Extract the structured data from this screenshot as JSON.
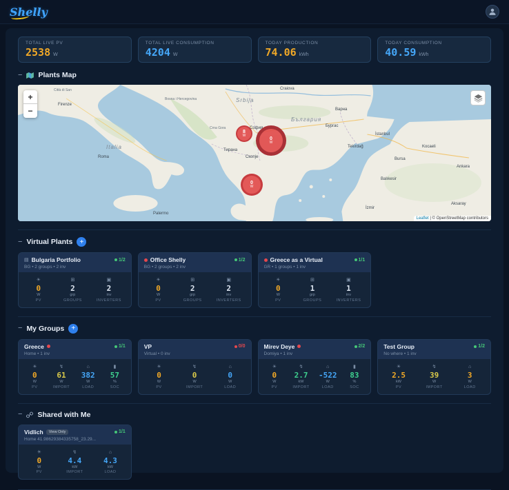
{
  "colors": {
    "accent_blue": "#2f80ed",
    "value_orange": "#f0a827",
    "value_blue": "#45a6f7",
    "value_yellow": "#d9c94a",
    "value_green": "#3ecf8e",
    "status_green": "#46c878",
    "status_red": "#e5484d",
    "marker_red": "#e24c4c"
  },
  "topbar": {
    "logo": "Shelly"
  },
  "stats": {
    "items": [
      {
        "label": "TOTAL LIVE PV",
        "value": "2538",
        "unit": "W"
      },
      {
        "label": "TOTAL LIVE CONSUMPTION",
        "value": "4204",
        "unit": "W"
      },
      {
        "label": "TODAY PRODUCTION",
        "value": "74.06",
        "unit": "kWh"
      },
      {
        "label": "TODAY CONSUMPTION",
        "value": "40.59",
        "unit": "kWh"
      }
    ]
  },
  "map": {
    "collapse": "−",
    "title": "Plants Map",
    "zoom_in": "+",
    "zoom_out": "−",
    "attribution_link": "Leaflet",
    "attribution_text": "| © OpenStreetMap contributors",
    "markers": [
      {
        "value": "8",
        "unit": "W"
      },
      {
        "value": "0",
        "unit": "W"
      },
      {
        "value": "0",
        "unit": "W"
      }
    ],
    "labels": [
      {
        "text": "Città di San"
      },
      {
        "text": "Firenze"
      },
      {
        "text": "Italia"
      },
      {
        "text": "Roma"
      },
      {
        "text": "Palermo"
      },
      {
        "text": "Bosna i Hercegovina"
      },
      {
        "text": "Srbija"
      },
      {
        "text": "Crna Gora"
      },
      {
        "text": "София"
      },
      {
        "text": "България"
      },
      {
        "text": "Скопје"
      },
      {
        "text": "Тирана"
      },
      {
        "text": "Craiova"
      },
      {
        "text": "Варна"
      },
      {
        "text": "Бургас"
      },
      {
        "text": "İstanbul"
      },
      {
        "text": "Tekirdağ"
      },
      {
        "text": "Bursa"
      },
      {
        "text": "Kocaeli"
      },
      {
        "text": "Balıkesir"
      },
      {
        "text": "Ankara"
      },
      {
        "text": "Aksaray"
      },
      {
        "text": "İzmir"
      }
    ]
  },
  "virtual_plants": {
    "collapse": "−",
    "title": "Virtual Plants",
    "add_label": "+",
    "items": [
      {
        "name": "Bulgaria Portfolio",
        "subtitle": "BG • 2 groups • 2 inv",
        "badge": "1/2",
        "stats": [
          {
            "icon": "sun-icon",
            "value": "0",
            "unit": "W",
            "label": "PV"
          },
          {
            "icon": "groups-icon",
            "value": "2",
            "unit": "grp",
            "label": "GROUPS"
          },
          {
            "icon": "inverter-icon",
            "value": "2",
            "unit": "inv",
            "label": "INVERTERS"
          }
        ]
      },
      {
        "name": "Office Shelly",
        "subtitle": "BG • 2 groups • 2 inv",
        "badge": "1/2",
        "stats": [
          {
            "icon": "sun-icon",
            "value": "0",
            "unit": "W",
            "label": "PV"
          },
          {
            "icon": "groups-icon",
            "value": "2",
            "unit": "grp",
            "label": "GROUPS"
          },
          {
            "icon": "inverter-icon",
            "value": "2",
            "unit": "inv",
            "label": "INVERTERS"
          }
        ]
      },
      {
        "name": "Greece as a Virtual",
        "subtitle": "GR • 1 groups • 1 inv",
        "badge": "1/1",
        "stats": [
          {
            "icon": "sun-icon",
            "value": "0",
            "unit": "W",
            "label": "PV"
          },
          {
            "icon": "groups-icon",
            "value": "1",
            "unit": "grp",
            "label": "GROUPS"
          },
          {
            "icon": "inverter-icon",
            "value": "1",
            "unit": "inv",
            "label": "INVERTERS"
          }
        ]
      }
    ]
  },
  "groups": {
    "collapse": "−",
    "title": "My Groups",
    "add_label": "+",
    "items": [
      {
        "name": "Greece",
        "subtitle": "Home • 1 inv",
        "badge": "1/1",
        "stats": [
          {
            "icon": "sun-icon",
            "value": "0",
            "unit": "W",
            "label": "PV"
          },
          {
            "icon": "bolt-icon",
            "value": "61",
            "unit": "W",
            "label": "IMPORT"
          },
          {
            "icon": "load-icon",
            "value": "382",
            "unit": "W",
            "label": "LOAD"
          },
          {
            "icon": "battery-icon",
            "value": "57",
            "unit": "%",
            "label": "SOC"
          }
        ]
      },
      {
        "name": "VP",
        "subtitle": "Virtual • 0 inv",
        "badge": "0/0",
        "stats": [
          {
            "icon": "sun-icon",
            "value": "0",
            "unit": "W",
            "label": "PV"
          },
          {
            "icon": "bolt-icon",
            "value": "0",
            "unit": "W",
            "label": "IMPORT"
          },
          {
            "icon": "load-icon",
            "value": "0",
            "unit": "W",
            "label": "LOAD"
          }
        ]
      },
      {
        "name": "Mirev Deye",
        "subtitle": "Domiya • 1 inv",
        "badge": "2/2",
        "stats": [
          {
            "icon": "sun-icon",
            "value": "0",
            "unit": "W",
            "label": "PV"
          },
          {
            "icon": "bolt-icon",
            "value": "2.7",
            "unit": "kW",
            "label": "IMPORT"
          },
          {
            "icon": "load-icon",
            "value": "-522",
            "unit": "W",
            "label": "LOAD"
          },
          {
            "icon": "battery-icon",
            "value": "83",
            "unit": "%",
            "label": "SOC"
          }
        ]
      },
      {
        "name": "Test Group",
        "subtitle": "No where • 1 inv",
        "badge": "1/2",
        "stats": [
          {
            "icon": "sun-icon",
            "value": "2.5",
            "unit": "kW",
            "label": "PV"
          },
          {
            "icon": "bolt-icon",
            "value": "39",
            "unit": "W",
            "label": "IMPORT"
          },
          {
            "icon": "load-icon",
            "value": "3",
            "unit": "W",
            "label": "LOAD"
          }
        ]
      }
    ]
  },
  "shared": {
    "collapse": "−",
    "title": "Shared with Me",
    "items": [
      {
        "name": "Vidlich",
        "tag": "View Only",
        "subtitle": "Home 41.98629384335758_23.29...",
        "badge": "1/1",
        "stats": [
          {
            "icon": "sun-icon",
            "value": "0",
            "unit": "W",
            "label": "PV"
          },
          {
            "icon": "bolt-icon",
            "value": "4.4",
            "unit": "kW",
            "label": "IMPORT"
          },
          {
            "icon": "load-icon",
            "value": "4.3",
            "unit": "kW",
            "label": "LOAD"
          }
        ]
      }
    ]
  }
}
